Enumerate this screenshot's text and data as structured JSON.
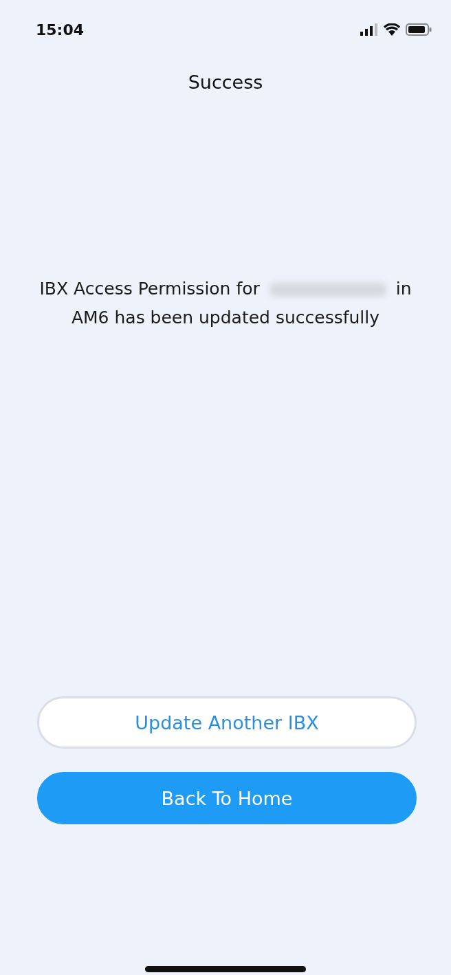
{
  "status_bar": {
    "time": "15:04"
  },
  "header": {
    "title": "Success"
  },
  "message": {
    "before": "IBX Access Permission for",
    "redacted": true,
    "after": "in AM6 has been updated successfully"
  },
  "buttons": [
    {
      "label": "Update Another IBX",
      "kind": "outline"
    },
    {
      "label": "Back To Home",
      "kind": "filled"
    }
  ]
}
